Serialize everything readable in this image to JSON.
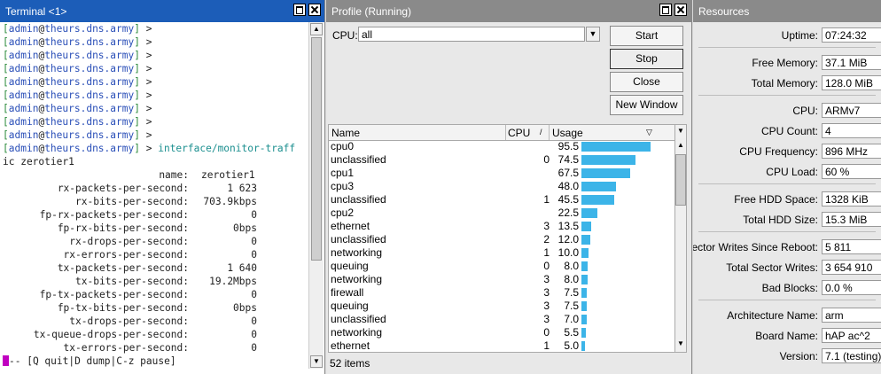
{
  "terminal": {
    "title": "Terminal <1>",
    "prompt_user": "admin",
    "prompt_host": "theurs.dns.army",
    "prompt_suffix": " >",
    "empty_prompt_count": 9,
    "command_part1": "interface/monitor-traff",
    "command_part2": "ic zerotier1",
    "stats": [
      {
        "label": "name:",
        "value": "zerotier1"
      },
      {
        "label": "rx-packets-per-second:",
        "value": "1 623"
      },
      {
        "label": "rx-bits-per-second:",
        "value": "703.9kbps"
      },
      {
        "label": "fp-rx-packets-per-second:",
        "value": "0"
      },
      {
        "label": "fp-rx-bits-per-second:",
        "value": "0bps"
      },
      {
        "label": "rx-drops-per-second:",
        "value": "0"
      },
      {
        "label": "rx-errors-per-second:",
        "value": "0"
      },
      {
        "label": "tx-packets-per-second:",
        "value": "1 640"
      },
      {
        "label": "tx-bits-per-second:",
        "value": "19.2Mbps"
      },
      {
        "label": "fp-tx-packets-per-second:",
        "value": "0"
      },
      {
        "label": "fp-tx-bits-per-second:",
        "value": "0bps"
      },
      {
        "label": "tx-drops-per-second:",
        "value": "0"
      },
      {
        "label": "tx-queue-drops-per-second:",
        "value": "0"
      },
      {
        "label": "tx-errors-per-second:",
        "value": "0"
      }
    ],
    "footer": "-- [Q quit|D dump|C-z pause]"
  },
  "profile": {
    "title": "Profile (Running)",
    "cpu_label": "CPU:",
    "cpu_value": "all",
    "buttons": {
      "start": "Start",
      "stop": "Stop",
      "close": "Close",
      "new_window": "New Window"
    },
    "columns": {
      "name": "Name",
      "cpu": "CPU",
      "usage": "Usage"
    },
    "rows": [
      {
        "name": "cpu0",
        "cpu": "",
        "usage": "95.5",
        "pct": 95.5
      },
      {
        "name": "unclassified",
        "cpu": "0",
        "usage": "74.5",
        "pct": 74.5
      },
      {
        "name": "cpu1",
        "cpu": "",
        "usage": "67.5",
        "pct": 67.5
      },
      {
        "name": "cpu3",
        "cpu": "",
        "usage": "48.0",
        "pct": 48.0
      },
      {
        "name": "unclassified",
        "cpu": "1",
        "usage": "45.5",
        "pct": 45.5
      },
      {
        "name": "cpu2",
        "cpu": "",
        "usage": "22.5",
        "pct": 22.5
      },
      {
        "name": "ethernet",
        "cpu": "3",
        "usage": "13.5",
        "pct": 13.5
      },
      {
        "name": "unclassified",
        "cpu": "2",
        "usage": "12.0",
        "pct": 12.0
      },
      {
        "name": "networking",
        "cpu": "1",
        "usage": "10.0",
        "pct": 10.0
      },
      {
        "name": "queuing",
        "cpu": "0",
        "usage": "8.0",
        "pct": 8.0
      },
      {
        "name": "networking",
        "cpu": "3",
        "usage": "8.0",
        "pct": 8.0
      },
      {
        "name": "firewall",
        "cpu": "3",
        "usage": "7.5",
        "pct": 7.5
      },
      {
        "name": "queuing",
        "cpu": "3",
        "usage": "7.5",
        "pct": 7.5
      },
      {
        "name": "unclassified",
        "cpu": "3",
        "usage": "7.0",
        "pct": 7.0
      },
      {
        "name": "networking",
        "cpu": "0",
        "usage": "5.5",
        "pct": 5.5
      },
      {
        "name": "ethernet",
        "cpu": "1",
        "usage": "5.0",
        "pct": 5.0
      }
    ],
    "items_count": "52 items",
    "bar_color": "#3cb4e8"
  },
  "resources": {
    "title": "Resources",
    "groups": [
      [
        {
          "label": "Uptime:",
          "value": "07:24:32"
        }
      ],
      [
        {
          "label": "Free Memory:",
          "value": "37.1 MiB"
        },
        {
          "label": "Total Memory:",
          "value": "128.0 MiB"
        }
      ],
      [
        {
          "label": "CPU:",
          "value": "ARMv7"
        },
        {
          "label": "CPU Count:",
          "value": "4"
        },
        {
          "label": "CPU Frequency:",
          "value": "896 MHz"
        },
        {
          "label": "CPU Load:",
          "value": "60 %"
        }
      ],
      [
        {
          "label": "Free HDD Space:",
          "value": "1328 KiB"
        },
        {
          "label": "Total HDD Size:",
          "value": "15.3 MiB"
        }
      ],
      [
        {
          "label": "Sector Writes Since Reboot:",
          "value": "5 811"
        },
        {
          "label": "Total Sector Writes:",
          "value": "3 654 910"
        },
        {
          "label": "Bad Blocks:",
          "value": "0.0 %"
        }
      ],
      [
        {
          "label": "Architecture Name:",
          "value": "arm"
        },
        {
          "label": "Board Name:",
          "value": "hAP ac^2"
        },
        {
          "label": "Version:",
          "value": "7.1 (testing)"
        }
      ]
    ]
  }
}
